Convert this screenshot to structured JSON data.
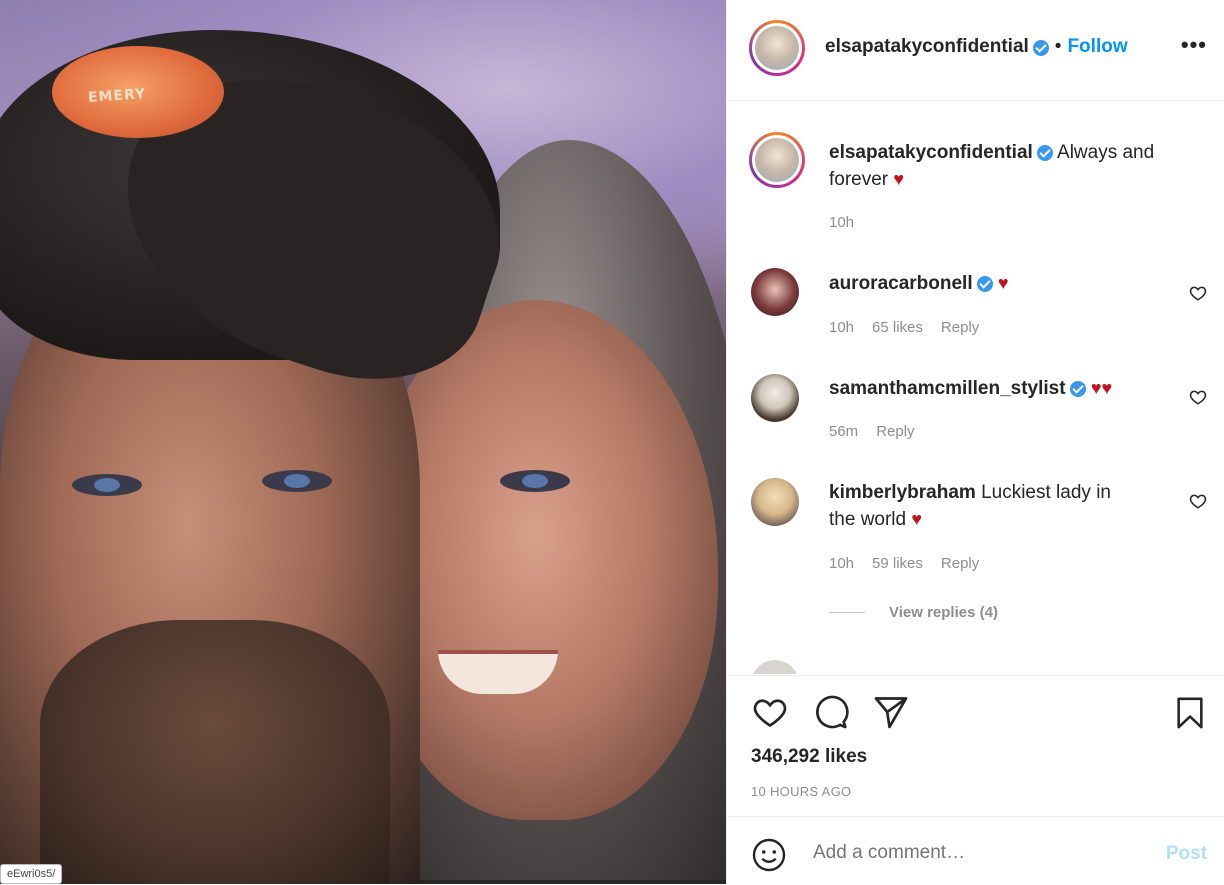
{
  "photo": {
    "badge_text": "EMERY",
    "url_tag": "eEwri0s5/"
  },
  "header": {
    "username": "elsapatakyconfidential",
    "separator": "•",
    "follow_label": "Follow",
    "more_label": "•••"
  },
  "caption": {
    "username": "elsapatakyconfidential",
    "text_line1": "Always and",
    "text_line2": "forever",
    "heart": "♥",
    "time": "10h"
  },
  "comments": [
    {
      "username": "auroracarbonell",
      "verified": true,
      "text": "",
      "hearts": "♥",
      "time": "10h",
      "likes": "65 likes",
      "reply": "Reply"
    },
    {
      "username": "samanthamcmillen_stylist",
      "verified": true,
      "text": "",
      "hearts": "♥♥",
      "time": "56m",
      "likes": "",
      "reply": "Reply"
    },
    {
      "username": "kimberlybraham",
      "verified": false,
      "text_line1": "Luckiest lady in",
      "text_line2": "the world",
      "hearts": "♥",
      "time": "10h",
      "likes": "59 likes",
      "reply": "Reply"
    }
  ],
  "view_replies": "View replies (4)",
  "actions": {
    "likes": "346,292 likes",
    "timestamp": "10 HOURS AGO"
  },
  "add_comment": {
    "placeholder": "Add a comment…",
    "post_label": "Post"
  },
  "colors": {
    "follow": "#0095f6",
    "verified": "#3897f0",
    "heart": "#c0141f",
    "muted": "#8e8e8e"
  }
}
